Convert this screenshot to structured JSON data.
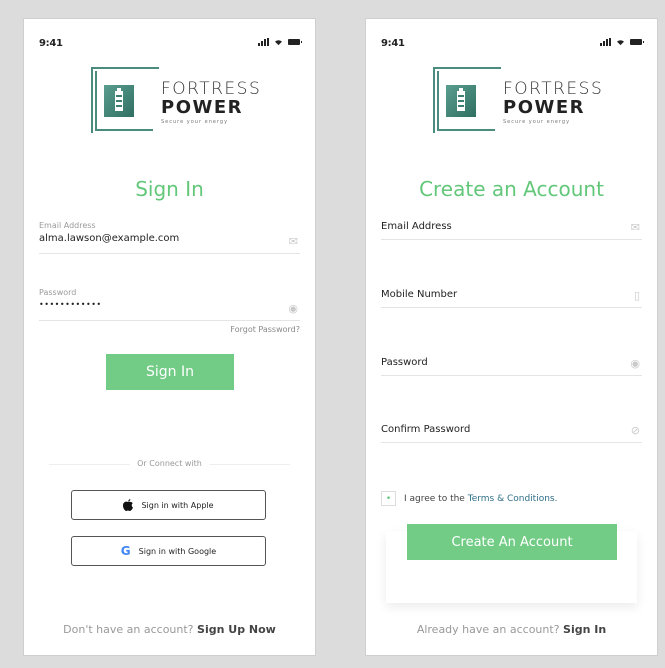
{
  "status": {
    "time": "9:41"
  },
  "logo": {
    "word1": "FORTRESS",
    "word2": "POWER",
    "tagline": "Secure your energy"
  },
  "signin": {
    "title": "Sign In",
    "email_label": "Email Address",
    "email_value": "alma.lawson@example.com",
    "password_label": "Password",
    "password_value": "••••••••••••",
    "forgot": "Forgot Password?",
    "button": "Sign In",
    "or_connect": "Or Connect with",
    "apple_button": "Sign in with Apple",
    "google_button": "Sign in with Google",
    "bottom_prefix": "Don't have an account?",
    "bottom_link": "Sign Up Now"
  },
  "register": {
    "title": "Create an Account",
    "email_label": "Email Address",
    "mobile_label": "Mobile Number",
    "password_label": "Password",
    "confirm_label": "Confirm Password",
    "agree_prefix": "I agree to the",
    "agree_link": "Terms & Conditions.",
    "button": "Create An Account",
    "bottom_prefix": "Already have an account?",
    "bottom_link": "Sign In"
  },
  "colors": {
    "accent": "#72cc86",
    "title": "#63c77a",
    "logo": "#4a8d7e"
  }
}
